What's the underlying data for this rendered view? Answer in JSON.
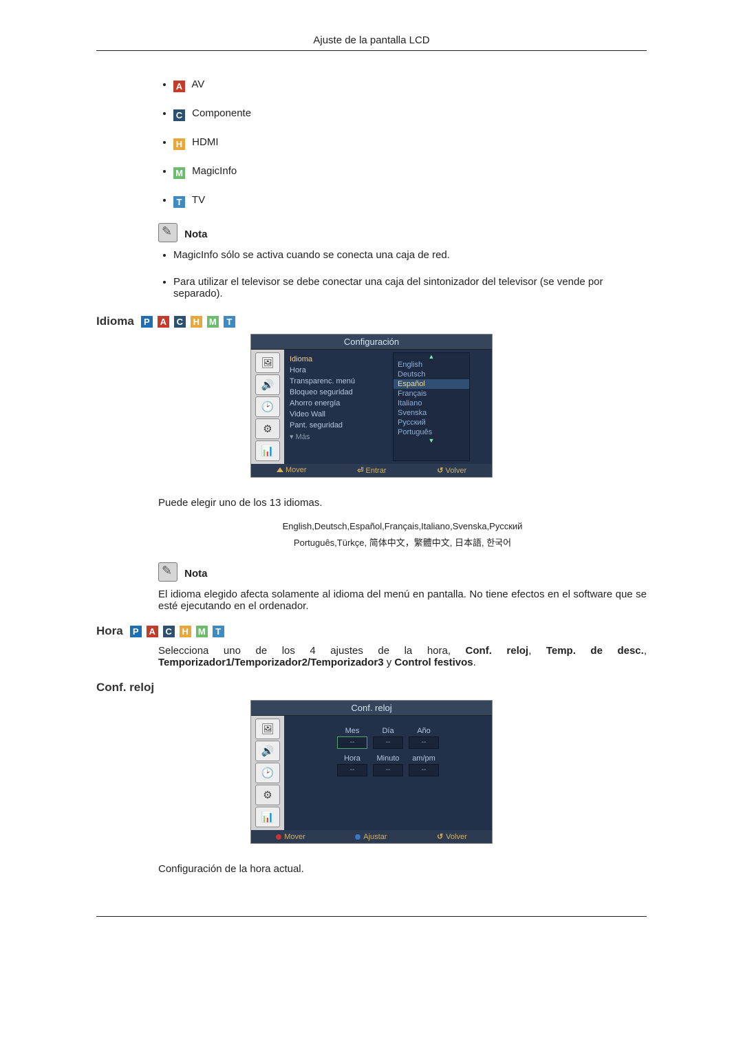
{
  "header": "Ajuste de la pantalla LCD",
  "sources": {
    "av": {
      "letter": "A",
      "label": "AV"
    },
    "comp": {
      "letter": "C",
      "label": "Componente"
    },
    "hdmi": {
      "letter": "H",
      "label": "HDMI"
    },
    "magicinfo": {
      "letter": "M",
      "label": "MagicInfo"
    },
    "tv": {
      "letter": "T",
      "label": "TV"
    }
  },
  "note_label": "Nota",
  "notes_top": [
    "MagicInfo sólo se activa cuando se conecta una caja de red.",
    "Para utilizar el televisor se debe conectar una caja del sintonizador del televisor (se vende por separado)."
  ],
  "badges": {
    "P": "P",
    "A": "A",
    "C": "C",
    "H": "H",
    "M": "M",
    "T": "T"
  },
  "idioma": {
    "title": "Idioma",
    "osd_title": "Configuración",
    "menu": [
      "Idioma",
      "Hora",
      "Transparenc. menú",
      "Bloqueo seguridad",
      "Ahorro energía",
      "Video Wall",
      "Pant. seguridad"
    ],
    "menu_more": "Más",
    "lang_list": [
      "English",
      "Deutsch",
      "Español",
      "Français",
      "Italiano",
      "Svenska",
      "Русский",
      "Português"
    ],
    "foot": {
      "mover": "Mover",
      "entrar": "Entrar",
      "volver": "Volver"
    },
    "body1": "Puede elegir uno de los 13 idiomas.",
    "langs_line1": "English,Deutsch,Español,Français,Italiano,Svenska,Русский",
    "langs_line2": "Português,Türkçe, 简体中文，繁體中文, 日本語, 한국어",
    "note": "El idioma elegido afecta solamente al idioma del menú en pantalla. No tiene efectos en el software que se esté ejecutando en el ordenador."
  },
  "hora": {
    "title": "Hora",
    "intro_a": "Selecciona uno de los 4 ajustes de la hora, ",
    "b1": "Conf. reloj",
    "s1": ", ",
    "b2": "Temp. de desc.",
    "s2": ", ",
    "b3": "Temporizador1/Temporizador2/Temporizador3",
    "s3": " y ",
    "b4": "Control festivos",
    "s4": "."
  },
  "conf": {
    "title": "Conf. reloj",
    "osd_title": "Conf. reloj",
    "row1": {
      "mes": "Mes",
      "dia": "Día",
      "ano": "Año"
    },
    "row2": {
      "hora": "Hora",
      "min": "Minuto",
      "ampm": "am/pm"
    },
    "dash": "--",
    "foot": {
      "mover": "Mover",
      "ajustar": "Ajustar",
      "volver": "Volver"
    },
    "caption": "Configuración de la hora actual."
  }
}
